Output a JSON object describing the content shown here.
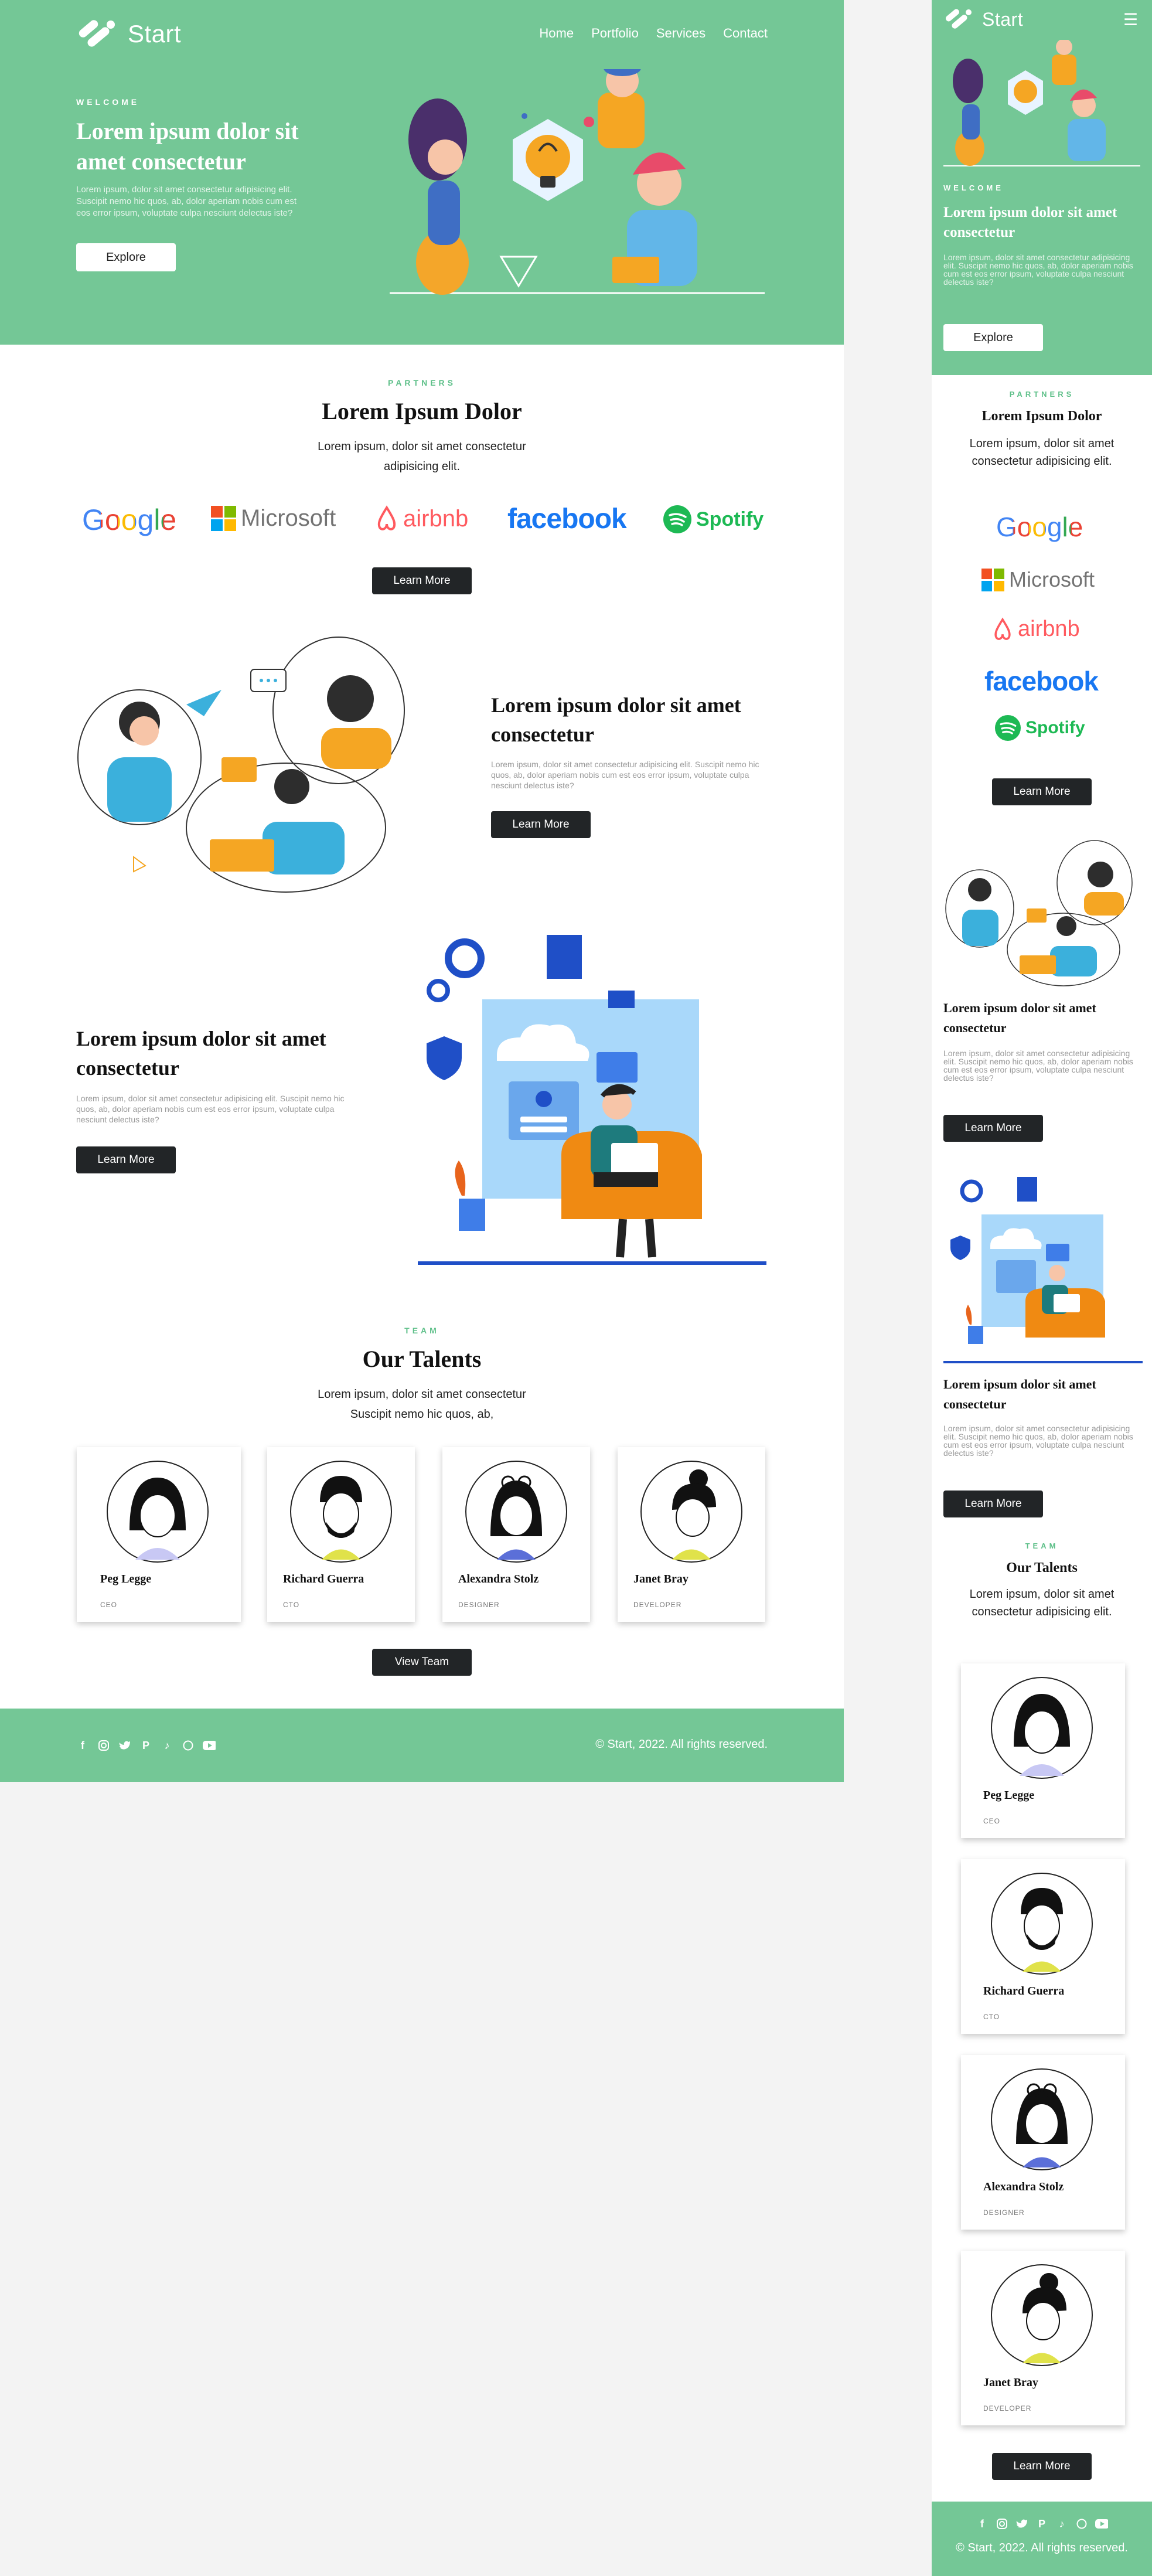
{
  "brand": {
    "name": "Start"
  },
  "nav": {
    "items": [
      "Home",
      "Portfolio",
      "Services",
      "Contact"
    ]
  },
  "hero": {
    "eyebrow": "WELCOME",
    "title": "Lorem ipsum dolor sit amet consectetur",
    "text": "Lorem ipsum, dolor sit amet consectetur adipisicing elit. Suscipit nemo hic quos, ab, dolor aperiam nobis cum est eos error ipsum, voluptate culpa nesciunt delectus iste?",
    "button": "Explore"
  },
  "partners": {
    "eyebrow": "PARTNERS",
    "title": "Lorem Ipsum Dolor",
    "text": "Lorem ipsum, dolor sit amet consectetur adipisicing elit.",
    "logos": [
      "Google",
      "Microsoft",
      "airbnb",
      "facebook",
      "Spotify"
    ],
    "button": "Learn More"
  },
  "feature1": {
    "title": "Lorem ipsum dolor sit amet consectetur",
    "text": "Lorem ipsum, dolor sit amet consectetur adipisicing elit. Suscipit nemo hic quos, ab, dolor aperiam nobis cum est eos error ipsum, voluptate culpa nesciunt delectus iste?",
    "button": "Learn More"
  },
  "feature2": {
    "title": "Lorem ipsum dolor sit amet consectetur",
    "text": "Lorem ipsum, dolor sit amet consectetur adipisicing elit. Suscipit nemo hic quos, ab, dolor aperiam nobis cum est eos error ipsum, voluptate culpa nesciunt delectus iste?",
    "button": "Learn More"
  },
  "team": {
    "eyebrow": "TEAM",
    "title": "Our Talents",
    "text_desktop": "Lorem ipsum, dolor sit amet consectetur Suscipit nemo hic quos, ab,",
    "text_mobile": "Lorem ipsum, dolor sit amet consectetur adipisicing elit.",
    "members": [
      {
        "name": "Peg Legge",
        "role": "CEO"
      },
      {
        "name": "Richard Guerra",
        "role": "CTO"
      },
      {
        "name": "Alexandra Stolz",
        "role": "DESIGNER"
      },
      {
        "name": "Janet Bray",
        "role": "DEVELOPER"
      }
    ],
    "button_desktop": "View Team",
    "button_mobile": "Learn More"
  },
  "footer": {
    "social": [
      "facebook-icon",
      "instagram-icon",
      "twitter-icon",
      "pinterest-icon",
      "tiktok-icon",
      "whatsapp-icon",
      "youtube-icon"
    ],
    "copyright": "© Start, 2022. All rights reserved."
  },
  "colors": {
    "green": "#74c796",
    "dark_button": "#222527",
    "accent_text": "#5fc08a"
  }
}
